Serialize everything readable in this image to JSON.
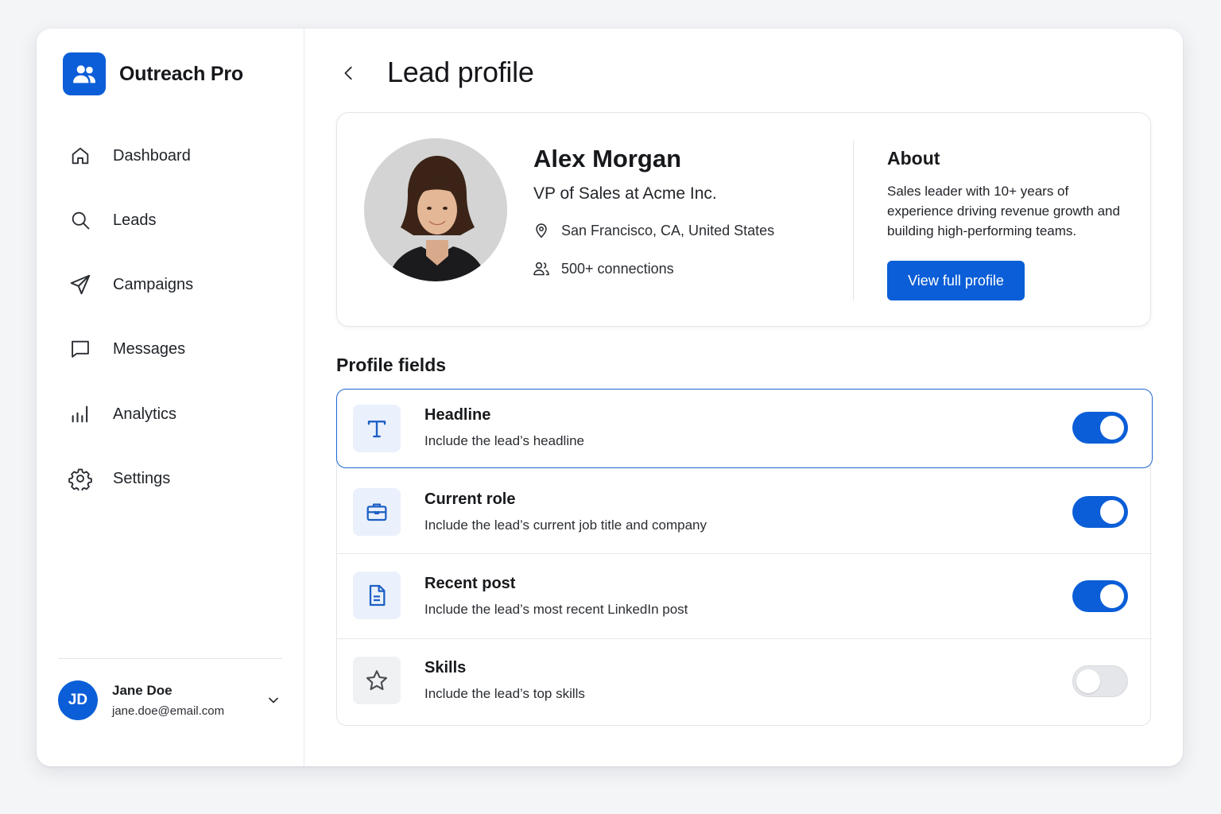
{
  "app": {
    "name": "Outreach Pro"
  },
  "sidebar": {
    "items": [
      {
        "label": "Dashboard",
        "icon": "home-icon"
      },
      {
        "label": "Leads",
        "icon": "search-icon"
      },
      {
        "label": "Campaigns",
        "icon": "send-icon"
      },
      {
        "label": "Messages",
        "icon": "message-icon"
      },
      {
        "label": "Analytics",
        "icon": "bar-chart-icon"
      },
      {
        "label": "Settings",
        "icon": "gear-icon"
      }
    ],
    "user": {
      "initials": "JD",
      "name": "Jane Doe",
      "email": "jane.doe@email.com"
    }
  },
  "header": {
    "title": "Lead profile"
  },
  "lead": {
    "name": "Alex Morgan",
    "title": "VP of Sales at Acme Inc.",
    "location": "San Francisco, CA, United States",
    "connections": "500+ connections",
    "about_title": "About",
    "about_text": "Sales leader with 10+ years of experience driving revenue growth and building high-performing teams.",
    "view_button": "View full profile"
  },
  "profile_fields": {
    "title": "Profile fields",
    "items": [
      {
        "title": "Headline",
        "description": "Include the lead’s headline",
        "enabled": true,
        "icon": "text-icon"
      },
      {
        "title": "Current role",
        "description": "Include the lead’s current job title and company",
        "enabled": true,
        "icon": "briefcase-icon"
      },
      {
        "title": "Recent post",
        "description": "Include the lead’s most recent LinkedIn post",
        "enabled": true,
        "icon": "document-icon"
      },
      {
        "title": "Skills",
        "description": "Include the lead’s top skills",
        "enabled": false,
        "icon": "star-icon"
      }
    ]
  },
  "colors": {
    "accent": "#0b5ed7",
    "toggle_off": "#e4e6ea"
  }
}
